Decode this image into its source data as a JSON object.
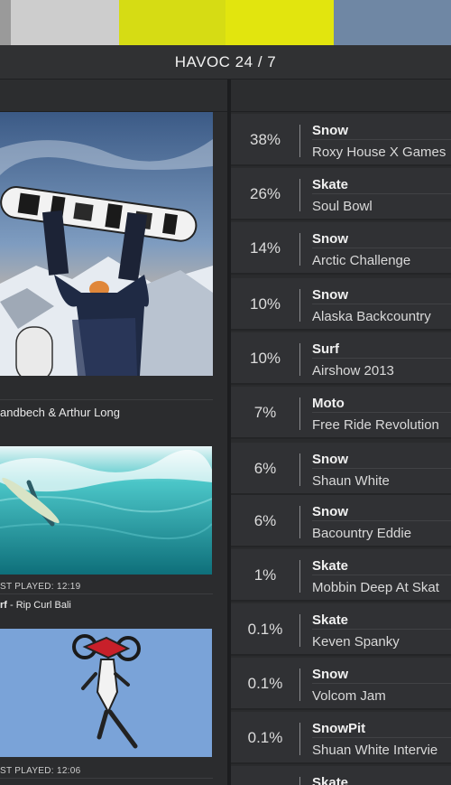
{
  "colors": {
    "swatches": [
      "#9a9a9a",
      "#cdcdcd",
      "#d6dc14",
      "#e2e50e",
      "#6f87a4"
    ],
    "background": "#2a2b2d",
    "row": "#303134"
  },
  "header": {
    "title": "HAVOC 24 / 7"
  },
  "feed": [
    {
      "caption": "andbech & Arthur Long",
      "category": "",
      "last_played": ""
    },
    {
      "caption": "- Rip Curl Bali",
      "category": "rf ",
      "last_played": "ST PLAYED: 12:19"
    },
    {
      "caption": "",
      "category": "",
      "last_played": "ST PLAYED: 12:06"
    }
  ],
  "list": [
    {
      "pct": "38%",
      "category": "Snow",
      "name": "Roxy House X Games"
    },
    {
      "pct": "26%",
      "category": "Skate",
      "name": "Soul Bowl"
    },
    {
      "pct": "14%",
      "category": "Snow",
      "name": "Arctic Challenge"
    },
    {
      "pct": "10%",
      "category": "Snow",
      "name": "Alaska Backcountry"
    },
    {
      "pct": "10%",
      "category": "Surf",
      "name": "Airshow 2013"
    },
    {
      "pct": "7%",
      "category": "Moto",
      "name": "Free Ride Revolution"
    },
    {
      "pct": "6%",
      "category": "Snow",
      "name": "Shaun White"
    },
    {
      "pct": "6%",
      "category": "Snow",
      "name": "Bacountry Eddie"
    },
    {
      "pct": "1%",
      "category": "Skate",
      "name": "Mobbin Deep At Skat"
    },
    {
      "pct": "0.1%",
      "category": "Skate",
      "name": "Keven Spanky"
    },
    {
      "pct": "0.1%",
      "category": "Snow",
      "name": "Volcom Jam"
    },
    {
      "pct": "0.1%",
      "category": "SnowPit",
      "name": "Shuan White Intervie"
    },
    {
      "pct": "",
      "category": "Skate",
      "name": ""
    }
  ]
}
